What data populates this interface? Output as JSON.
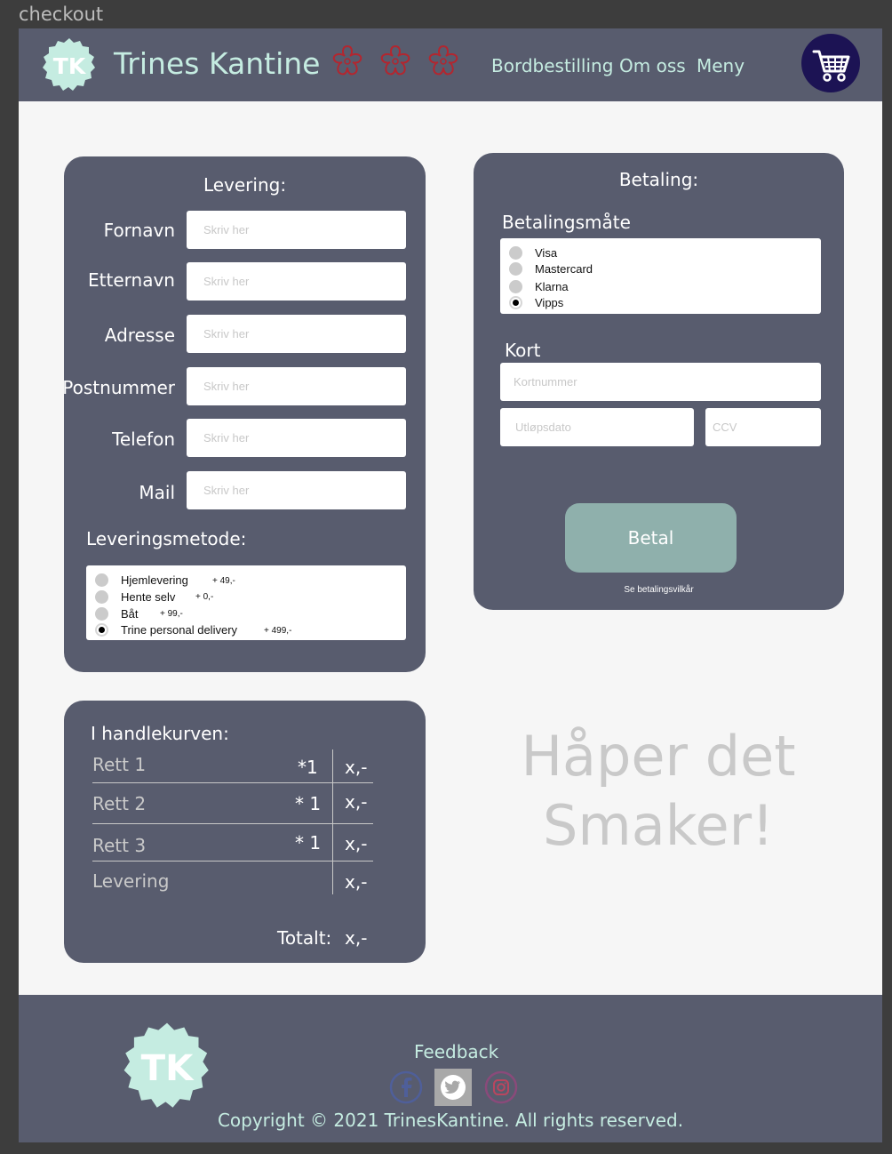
{
  "frame": {
    "label": "checkout"
  },
  "header": {
    "logo_text": "TK",
    "brand": "Trines Kantine",
    "nav": [
      "Bordbestilling",
      "Om oss",
      "Meny"
    ],
    "cart_icon": "shopping-cart-icon"
  },
  "delivery": {
    "title": "Levering:",
    "fields": [
      {
        "label": "Fornavn",
        "placeholder": "Skriv her"
      },
      {
        "label": "Etternavn",
        "placeholder": "Skriv her"
      },
      {
        "label": "Adresse",
        "placeholder": "Skriv her"
      },
      {
        "label": "Postnummer",
        "placeholder": "Skriv her"
      },
      {
        "label": "Telefon",
        "placeholder": "Skriv her"
      },
      {
        "label": "Mail",
        "placeholder": "Skriv her"
      }
    ],
    "method_title": "Leveringsmetode:",
    "methods": [
      {
        "label": "Hjemlevering",
        "price": "+ 49,-",
        "selected": false
      },
      {
        "label": "Hente selv",
        "price": "+ 0,-",
        "selected": false
      },
      {
        "label": "Båt",
        "price": "+ 99,-",
        "selected": false
      },
      {
        "label": "Trine personal delivery",
        "price": "+ 499,-",
        "selected": true
      }
    ]
  },
  "payment": {
    "title": "Betaling:",
    "method_title": "Betalingsmåte",
    "methods": [
      {
        "label": "Visa",
        "selected": false
      },
      {
        "label": "Mastercard",
        "selected": false
      },
      {
        "label": "Klarna",
        "selected": false
      },
      {
        "label": "Vipps",
        "selected": true
      }
    ],
    "card_title": "Kort",
    "card_number_placeholder": "Kortnummer",
    "expiry_placeholder": "Utløpsdato",
    "ccv_placeholder": "CCV",
    "pay_button": "Betal",
    "terms_link": "Se betalingsvilkår"
  },
  "cart": {
    "title": "I  handlekurven:",
    "items": [
      {
        "name": "Rett 1",
        "qty": "*1",
        "price": "x,-"
      },
      {
        "name": "Rett 2",
        "qty": "* 1",
        "price": "x,-"
      },
      {
        "name": "Rett 3",
        "qty": "* 1",
        "price": "x,-"
      }
    ],
    "delivery_label": "Levering",
    "delivery_price": "x,-",
    "total_label": "Totalt:",
    "total_value": "x,-"
  },
  "slogan": {
    "line1": "Håper det",
    "line2": "Smaker!"
  },
  "footer": {
    "logo_text": "TK",
    "feedback": "Feedback",
    "social_icons": [
      "facebook-icon",
      "twitter-icon",
      "instagram-icon"
    ],
    "copyright": "Copyright © 2021 TrinesKantine. All rights reserved."
  },
  "colors": {
    "panel": "#585c6e",
    "accent_mint": "#c5ece1",
    "button": "#8fb0ac",
    "cart_circle": "#1c1354",
    "star_outline": "#b3262f"
  }
}
